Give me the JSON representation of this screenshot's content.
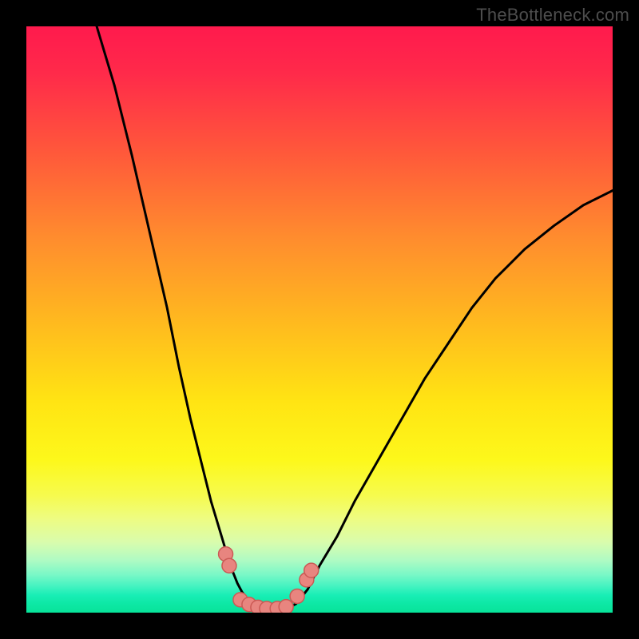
{
  "watermark": "TheBottleneck.com",
  "colors": {
    "frame": "#000000",
    "curve": "#000000",
    "marker_fill": "#e8857f",
    "marker_stroke": "#cb5a55"
  },
  "chart_data": {
    "type": "line",
    "title": "",
    "xlabel": "",
    "ylabel": "",
    "xlim": [
      0,
      100
    ],
    "ylim": [
      0,
      100
    ],
    "axes_hidden": true,
    "series": [
      {
        "name": "left-curve",
        "x": [
          12,
          15,
          18,
          21,
          24,
          26,
          28,
          30,
          31.5,
          33,
          34.2,
          35.2,
          36,
          36.8,
          38,
          40,
          42
        ],
        "y": [
          100,
          90,
          78,
          65,
          52,
          42,
          33,
          25,
          19,
          14,
          10,
          7,
          5,
          3.5,
          2,
          1,
          0.5
        ]
      },
      {
        "name": "right-curve",
        "x": [
          44,
          46,
          48,
          50,
          53,
          56,
          60,
          64,
          68,
          72,
          76,
          80,
          85,
          90,
          95,
          100
        ],
        "y": [
          0.5,
          1.5,
          4,
          8,
          13,
          19,
          26,
          33,
          40,
          46,
          52,
          57,
          62,
          66,
          69.5,
          72
        ]
      }
    ],
    "markers": {
      "name": "bottom-cluster",
      "points": [
        {
          "x": 34.0,
          "y": 10.0
        },
        {
          "x": 34.6,
          "y": 8.0
        },
        {
          "x": 36.5,
          "y": 2.2
        },
        {
          "x": 38.0,
          "y": 1.4
        },
        {
          "x": 39.5,
          "y": 0.9
        },
        {
          "x": 41.0,
          "y": 0.7
        },
        {
          "x": 42.8,
          "y": 0.7
        },
        {
          "x": 44.3,
          "y": 1.0
        },
        {
          "x": 46.2,
          "y": 2.8
        },
        {
          "x": 47.8,
          "y": 5.6
        },
        {
          "x": 48.6,
          "y": 7.2
        }
      ]
    }
  }
}
